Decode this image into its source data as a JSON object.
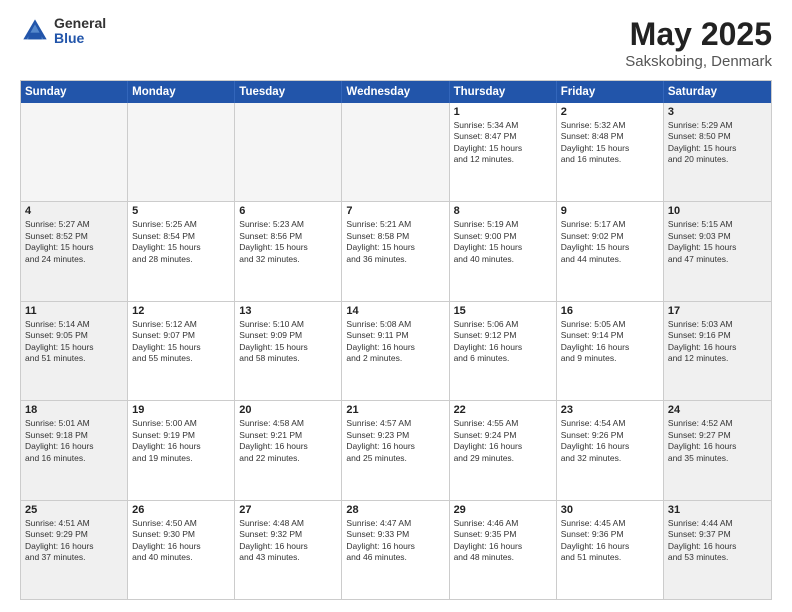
{
  "logo": {
    "general": "General",
    "blue": "Blue"
  },
  "title": "May 2025",
  "subtitle": "Sakskobing, Denmark",
  "days_of_week": [
    "Sunday",
    "Monday",
    "Tuesday",
    "Wednesday",
    "Thursday",
    "Friday",
    "Saturday"
  ],
  "weeks": [
    [
      {
        "day": "",
        "empty": true
      },
      {
        "day": "",
        "empty": true
      },
      {
        "day": "",
        "empty": true
      },
      {
        "day": "",
        "empty": true
      },
      {
        "day": "1",
        "info": "Sunrise: 5:34 AM\nSunset: 8:47 PM\nDaylight: 15 hours\nand 12 minutes."
      },
      {
        "day": "2",
        "info": "Sunrise: 5:32 AM\nSunset: 8:48 PM\nDaylight: 15 hours\nand 16 minutes."
      },
      {
        "day": "3",
        "info": "Sunrise: 5:29 AM\nSunset: 8:50 PM\nDaylight: 15 hours\nand 20 minutes.",
        "weekend": true
      }
    ],
    [
      {
        "day": "4",
        "info": "Sunrise: 5:27 AM\nSunset: 8:52 PM\nDaylight: 15 hours\nand 24 minutes.",
        "weekend": true
      },
      {
        "day": "5",
        "info": "Sunrise: 5:25 AM\nSunset: 8:54 PM\nDaylight: 15 hours\nand 28 minutes."
      },
      {
        "day": "6",
        "info": "Sunrise: 5:23 AM\nSunset: 8:56 PM\nDaylight: 15 hours\nand 32 minutes."
      },
      {
        "day": "7",
        "info": "Sunrise: 5:21 AM\nSunset: 8:58 PM\nDaylight: 15 hours\nand 36 minutes."
      },
      {
        "day": "8",
        "info": "Sunrise: 5:19 AM\nSunset: 9:00 PM\nDaylight: 15 hours\nand 40 minutes."
      },
      {
        "day": "9",
        "info": "Sunrise: 5:17 AM\nSunset: 9:02 PM\nDaylight: 15 hours\nand 44 minutes."
      },
      {
        "day": "10",
        "info": "Sunrise: 5:15 AM\nSunset: 9:03 PM\nDaylight: 15 hours\nand 47 minutes.",
        "weekend": true
      }
    ],
    [
      {
        "day": "11",
        "info": "Sunrise: 5:14 AM\nSunset: 9:05 PM\nDaylight: 15 hours\nand 51 minutes.",
        "weekend": true
      },
      {
        "day": "12",
        "info": "Sunrise: 5:12 AM\nSunset: 9:07 PM\nDaylight: 15 hours\nand 55 minutes."
      },
      {
        "day": "13",
        "info": "Sunrise: 5:10 AM\nSunset: 9:09 PM\nDaylight: 15 hours\nand 58 minutes."
      },
      {
        "day": "14",
        "info": "Sunrise: 5:08 AM\nSunset: 9:11 PM\nDaylight: 16 hours\nand 2 minutes."
      },
      {
        "day": "15",
        "info": "Sunrise: 5:06 AM\nSunset: 9:12 PM\nDaylight: 16 hours\nand 6 minutes."
      },
      {
        "day": "16",
        "info": "Sunrise: 5:05 AM\nSunset: 9:14 PM\nDaylight: 16 hours\nand 9 minutes."
      },
      {
        "day": "17",
        "info": "Sunrise: 5:03 AM\nSunset: 9:16 PM\nDaylight: 16 hours\nand 12 minutes.",
        "weekend": true
      }
    ],
    [
      {
        "day": "18",
        "info": "Sunrise: 5:01 AM\nSunset: 9:18 PM\nDaylight: 16 hours\nand 16 minutes.",
        "weekend": true
      },
      {
        "day": "19",
        "info": "Sunrise: 5:00 AM\nSunset: 9:19 PM\nDaylight: 16 hours\nand 19 minutes."
      },
      {
        "day": "20",
        "info": "Sunrise: 4:58 AM\nSunset: 9:21 PM\nDaylight: 16 hours\nand 22 minutes."
      },
      {
        "day": "21",
        "info": "Sunrise: 4:57 AM\nSunset: 9:23 PM\nDaylight: 16 hours\nand 25 minutes."
      },
      {
        "day": "22",
        "info": "Sunrise: 4:55 AM\nSunset: 9:24 PM\nDaylight: 16 hours\nand 29 minutes."
      },
      {
        "day": "23",
        "info": "Sunrise: 4:54 AM\nSunset: 9:26 PM\nDaylight: 16 hours\nand 32 minutes."
      },
      {
        "day": "24",
        "info": "Sunrise: 4:52 AM\nSunset: 9:27 PM\nDaylight: 16 hours\nand 35 minutes.",
        "weekend": true
      }
    ],
    [
      {
        "day": "25",
        "info": "Sunrise: 4:51 AM\nSunset: 9:29 PM\nDaylight: 16 hours\nand 37 minutes.",
        "weekend": true
      },
      {
        "day": "26",
        "info": "Sunrise: 4:50 AM\nSunset: 9:30 PM\nDaylight: 16 hours\nand 40 minutes."
      },
      {
        "day": "27",
        "info": "Sunrise: 4:48 AM\nSunset: 9:32 PM\nDaylight: 16 hours\nand 43 minutes."
      },
      {
        "day": "28",
        "info": "Sunrise: 4:47 AM\nSunset: 9:33 PM\nDaylight: 16 hours\nand 46 minutes."
      },
      {
        "day": "29",
        "info": "Sunrise: 4:46 AM\nSunset: 9:35 PM\nDaylight: 16 hours\nand 48 minutes."
      },
      {
        "day": "30",
        "info": "Sunrise: 4:45 AM\nSunset: 9:36 PM\nDaylight: 16 hours\nand 51 minutes."
      },
      {
        "day": "31",
        "info": "Sunrise: 4:44 AM\nSunset: 9:37 PM\nDaylight: 16 hours\nand 53 minutes.",
        "weekend": true
      }
    ]
  ]
}
